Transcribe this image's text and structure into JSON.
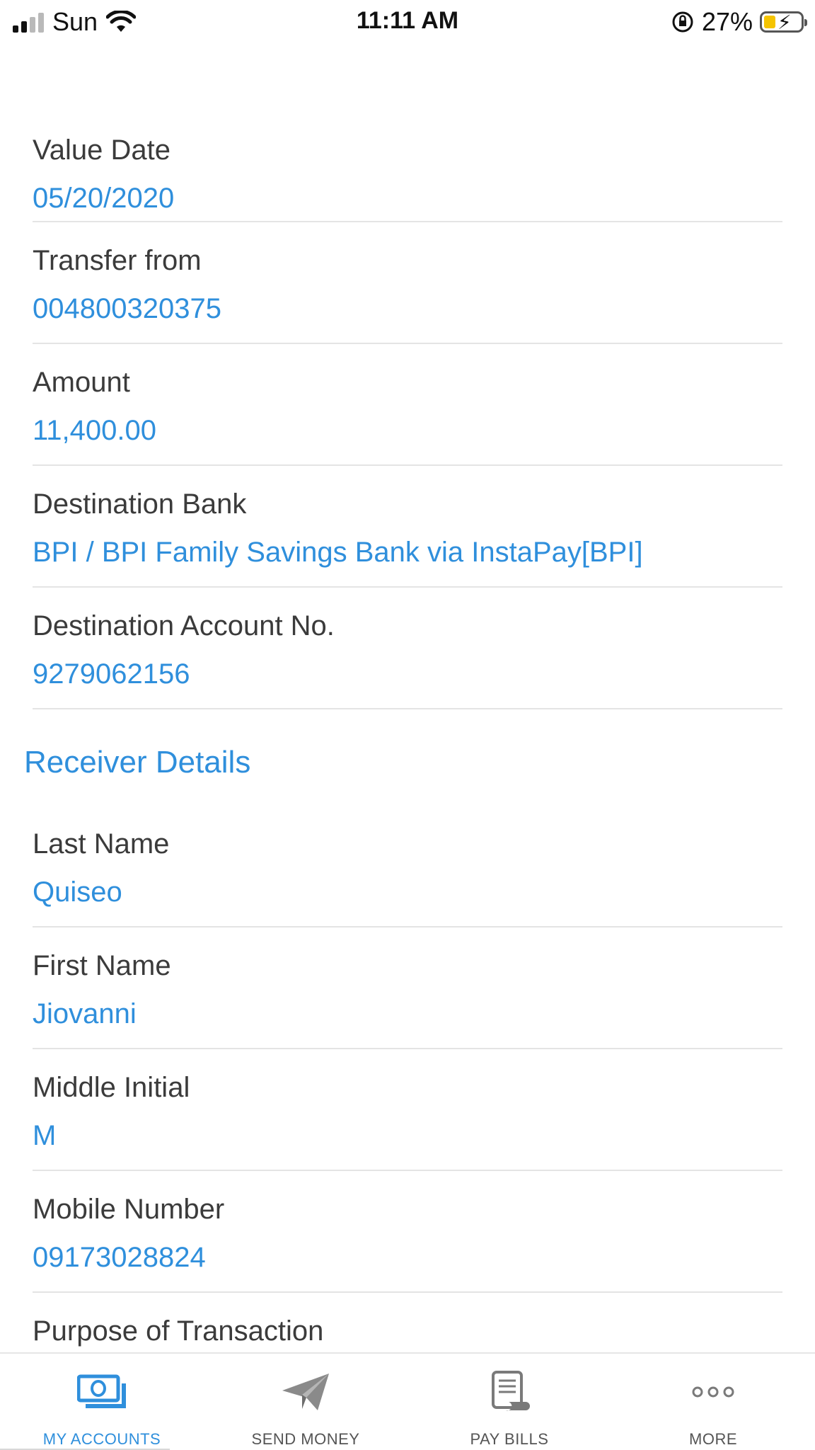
{
  "status_bar": {
    "carrier": "Sun",
    "time": "11:11 AM",
    "battery_percent": "27%"
  },
  "fields": [
    {
      "label": "Value Date",
      "value": "05/20/2020"
    },
    {
      "label": "Transfer from",
      "value": "004800320375"
    },
    {
      "label": "Amount",
      "value": "11,400.00"
    },
    {
      "label": "Destination Bank",
      "value": "BPI / BPI Family Savings Bank via InstaPay[BPI]"
    },
    {
      "label": "Destination Account No.",
      "value": "9279062156"
    }
  ],
  "receiver": {
    "title": "Receiver Details",
    "fields": [
      {
        "label": "Last Name",
        "value": "Quiseo"
      },
      {
        "label": "First Name",
        "value": "Jiovanni"
      },
      {
        "label": "Middle Initial",
        "value": "M"
      },
      {
        "label": "Mobile Number",
        "value": "09173028824"
      },
      {
        "label": "Purpose of Transaction",
        "value": ""
      }
    ]
  },
  "tabs": [
    {
      "label": "MY ACCOUNTS",
      "icon": "money-icon",
      "active": true
    },
    {
      "label": "SEND MONEY",
      "icon": "paper-plane-icon",
      "active": false
    },
    {
      "label": "PAY BILLS",
      "icon": "receipt-icon",
      "active": false
    },
    {
      "label": "MORE",
      "icon": "more-dots-icon",
      "active": false
    }
  ],
  "colors": {
    "accent": "#2f8fdc",
    "label": "#3b3b3b",
    "divider": "#e4e4e4",
    "tab_inactive": "#777777"
  }
}
